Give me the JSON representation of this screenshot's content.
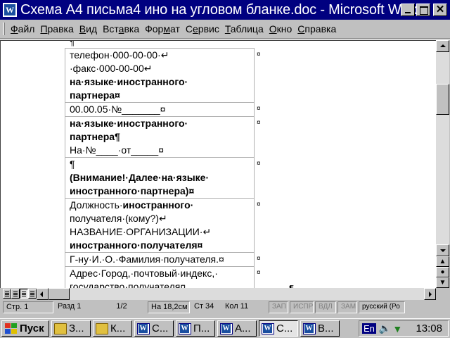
{
  "window": {
    "title": "Схема А4 письма4 ино на угловом бланке.doc - Microsoft Word",
    "app_icon": "word-icon",
    "close_glyph": "✕"
  },
  "menu": {
    "items": [
      {
        "accel": "Ф",
        "rest": "айл"
      },
      {
        "accel": "П",
        "rest": "равка"
      },
      {
        "accel": "В",
        "rest": "ид"
      },
      {
        "pre": "Вст",
        "accel": "а",
        "rest": "вка"
      },
      {
        "pre": "Фор",
        "accel": "м",
        "rest": "ат"
      },
      {
        "pre": "С",
        "accel": "е",
        "rest": "рвис"
      },
      {
        "accel": "Т",
        "rest": "аблица"
      },
      {
        "accel": "О",
        "rest": "кно"
      },
      {
        "accel": "С",
        "rest": "правка"
      }
    ]
  },
  "document": {
    "pilcrow": "¶",
    "cell_end": "¤",
    "rows": [
      {
        "lines": [
          {
            "text": "телефон·000-00-00·↵",
            "bold": false
          },
          {
            "text": "·факс·000-00-00↵",
            "bold": false
          },
          {
            "text": "на·языке·иностранного·",
            "bold": true
          },
          {
            "text": "партнера¤",
            "bold": true
          }
        ]
      },
      {
        "lines": [
          {
            "text": "00.00.05·№_______¤",
            "bold": false
          }
        ]
      },
      {
        "lines": [
          {
            "text": "на·языке·иностранного·",
            "bold": true
          },
          {
            "text": "партнера¶",
            "bold": true
          },
          {
            "text": "На·№____·от_____¤",
            "bold": false
          }
        ]
      },
      {
        "lines": [
          {
            "text": "¶",
            "bold": false
          },
          {
            "text": "(Внимание!·Далее·на·языке·",
            "bold": true
          },
          {
            "text": "иностранного·партнера)¤",
            "bold": true
          }
        ]
      },
      {
        "lines": [
          {
            "text": "Должность·иностранного·",
            "bold": false,
            "bold_part": "иностранного·",
            "plain_part": "Должность·"
          },
          {
            "text": "получателя·(кому?)↵",
            "bold": false
          },
          {
            "text": "НАЗВАНИЕ·ОРГАНИЗАЦИИ·↵",
            "bold": false
          },
          {
            "text": "иностранного·получателя¤",
            "bold": true
          }
        ]
      },
      {
        "lines": [
          {
            "text": "Г-ну·И.·О.·Фамилия·получателя.¤",
            "bold": false
          }
        ]
      },
      {
        "lines": [
          {
            "text": "Адрес·Город,·почтовый·индекс,·",
            "bold": false
          },
          {
            "text": "государство·получателя¤",
            "bold": false
          }
        ]
      }
    ]
  },
  "statusbar": {
    "page": "Стр.  1",
    "section": "Разд  1",
    "pages": "1/2",
    "position": "На 18,2см",
    "line": "Ст  34",
    "column": "Кол  11",
    "rec": "ЗАП",
    "trk": "ИСПР",
    "ext": "ВДЛ",
    "ovr": "ЗАМ",
    "language": "русский (Ро"
  },
  "taskbar": {
    "start": "Пуск",
    "tasks": [
      {
        "label": "З...",
        "icon": "folder-icon",
        "active": false
      },
      {
        "label": "К...",
        "icon": "folder-icon",
        "active": false
      },
      {
        "label": "С...",
        "icon": "word-icon",
        "active": false
      },
      {
        "label": "П...",
        "icon": "word-icon",
        "active": false
      },
      {
        "label": "А...",
        "icon": "word-icon",
        "active": false
      },
      {
        "label": "С...",
        "icon": "word-icon",
        "active": true
      },
      {
        "label": "В...",
        "icon": "word-icon",
        "active": false
      }
    ],
    "lang": "En",
    "clock": "13:08"
  },
  "colors": {
    "titlebar": "#000080",
    "face": "#c0c0c0",
    "paper": "#ffffff"
  }
}
